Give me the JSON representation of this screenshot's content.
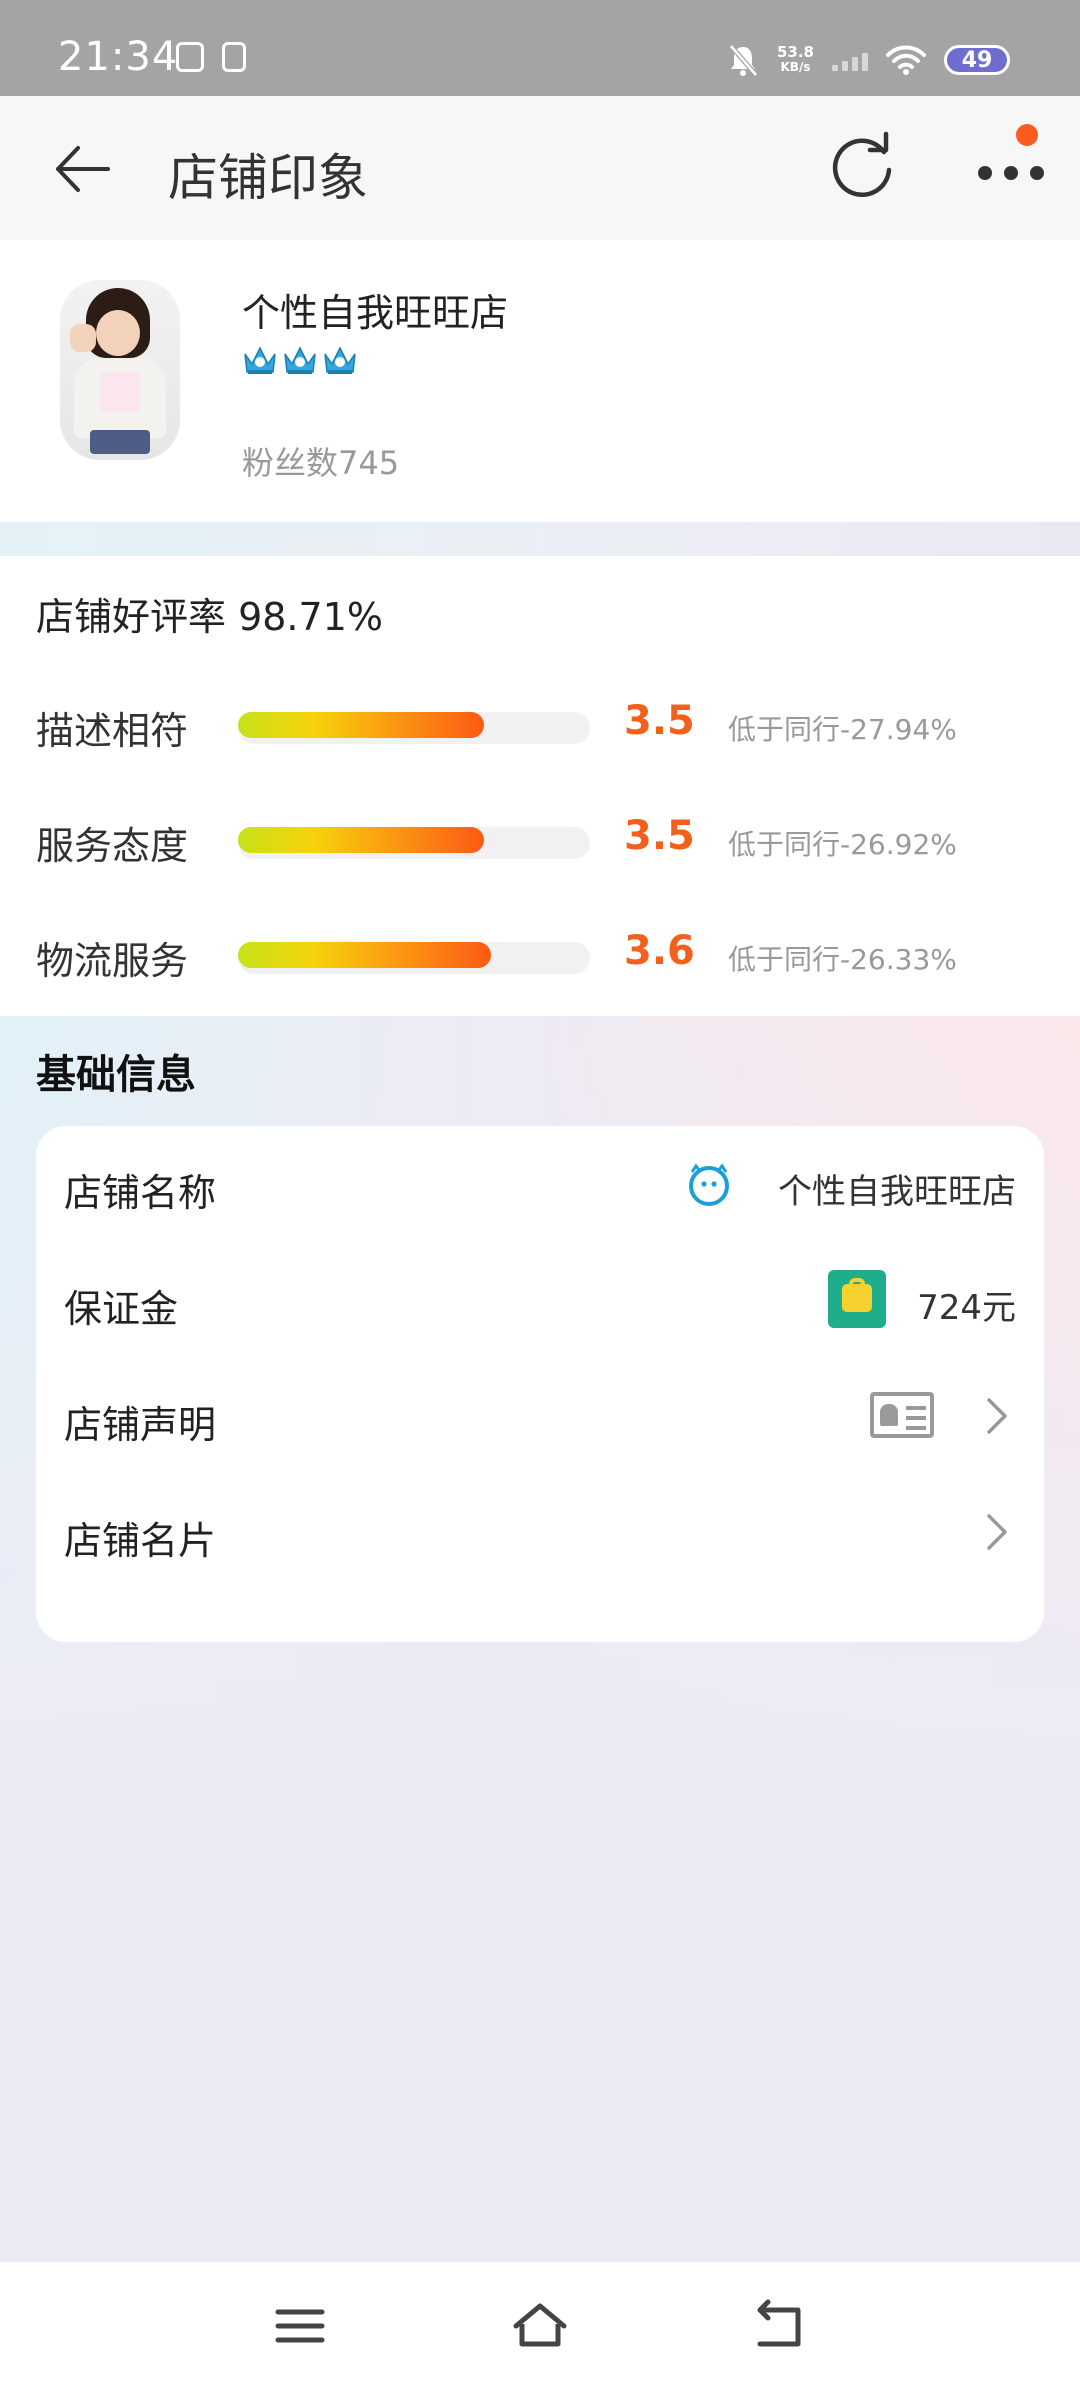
{
  "status_bar": {
    "time": "21:34",
    "speed_value": "53.8",
    "speed_unit": "KB/s",
    "battery": "49"
  },
  "header": {
    "title": "店铺印象"
  },
  "shop": {
    "name": "个性自我旺旺店",
    "followers": "粉丝数745",
    "crown_count": 3
  },
  "ratings": {
    "good_rate": "店铺好评率 98.71%",
    "items": [
      {
        "label": "描述相符",
        "score": "3.5",
        "score_value": 3.5,
        "compare": "低于同行-27.94%"
      },
      {
        "label": "服务态度",
        "score": "3.5",
        "score_value": 3.5,
        "compare": "低于同行-26.92%"
      },
      {
        "label": "物流服务",
        "score": "3.6",
        "score_value": 3.6,
        "compare": "低于同行-26.33%"
      }
    ],
    "max_score": 5
  },
  "basic_info": {
    "title": "基础信息",
    "rows": [
      {
        "label": "店铺名称",
        "value": "个性自我旺旺店",
        "icon": "wangwang-icon"
      },
      {
        "label": "保证金",
        "value": "724元",
        "icon": "deposit-icon"
      },
      {
        "label": "店铺声明",
        "value": "",
        "icon": "id-card-icon"
      },
      {
        "label": "店铺名片",
        "value": "",
        "icon": ""
      }
    ]
  },
  "colors": {
    "accent": "#f2601b",
    "header_bg": "#f7f7f7",
    "page_bg": "#ecebf5",
    "notification_dot": "#ff5a1f"
  }
}
